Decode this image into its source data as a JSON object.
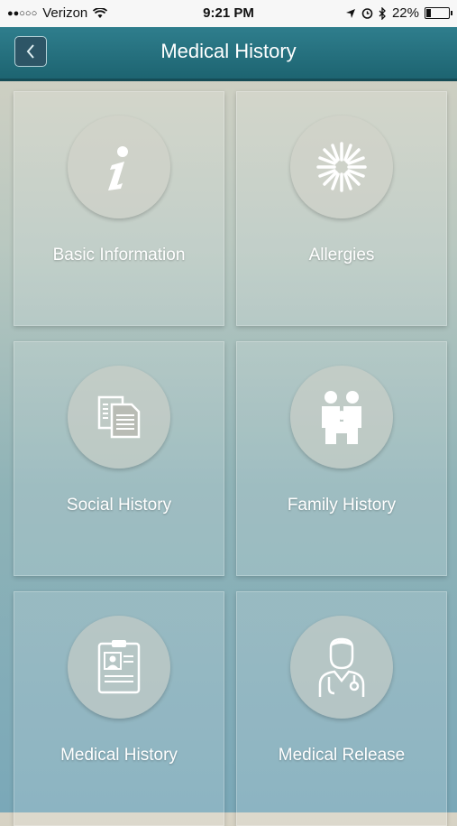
{
  "status_bar": {
    "carrier": "Verizon",
    "time": "9:21 PM",
    "battery_percent": "22%",
    "battery_level": 0.22
  },
  "header": {
    "title": "Medical History"
  },
  "tiles": [
    {
      "label": "Basic Information",
      "icon": "info-icon"
    },
    {
      "label": "Allergies",
      "icon": "allergy-burst-icon"
    },
    {
      "label": "Social History",
      "icon": "documents-icon"
    },
    {
      "label": "Family History",
      "icon": "family-icon"
    },
    {
      "label": "Medical History",
      "icon": "id-card-icon"
    },
    {
      "label": "Medical Release",
      "icon": "doctor-icon"
    }
  ]
}
